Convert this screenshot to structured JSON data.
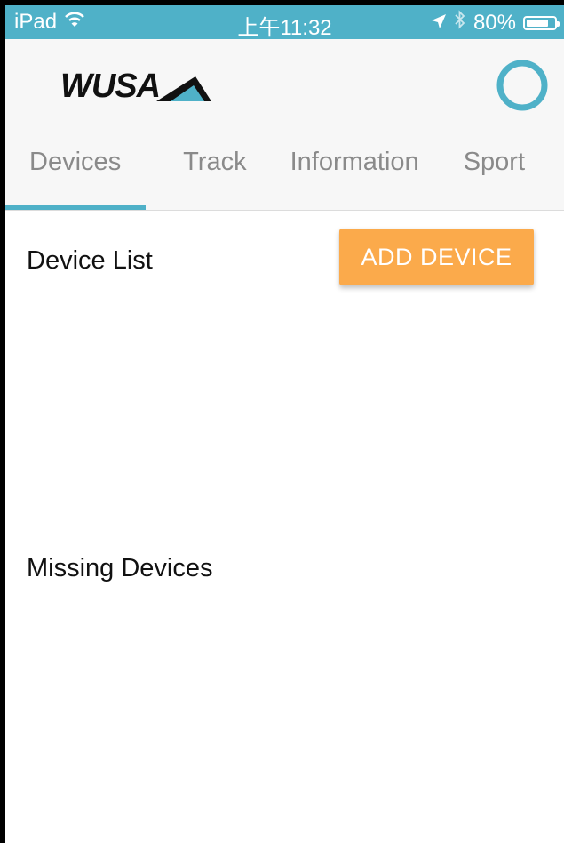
{
  "status_bar": {
    "device": "iPad",
    "time": "上午11:32",
    "battery": "80%",
    "battery_level": 0.8
  },
  "header": {
    "logo_text": "WUSA"
  },
  "tabs": [
    {
      "label": "Devices",
      "active": true
    },
    {
      "label": "Track",
      "active": false
    },
    {
      "label": "Information",
      "active": false
    },
    {
      "label": "Sport",
      "active": false
    }
  ],
  "devices_page": {
    "device_list_title": "Device List",
    "add_device_label": "ADD DEVICE",
    "missing_devices_title": "Missing Devices"
  },
  "colors": {
    "accent": "#4fb1c8",
    "button": "#fbaa4b",
    "header_bg": "#f7f7f7"
  }
}
